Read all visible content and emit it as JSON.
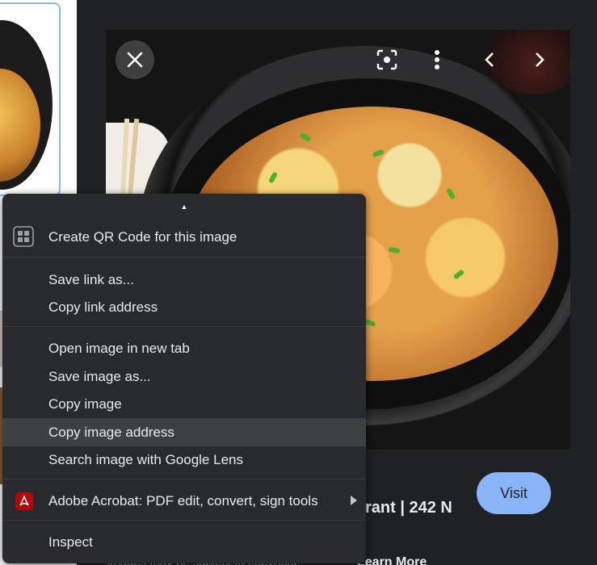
{
  "results_panel": {
    "title_fragment": "rant | 242 N",
    "caption_fragment": "Images may be subject to copyright.",
    "learn_more_fragment": "Learn More",
    "visit_label": "Visit"
  },
  "overlay_icons": [
    "close-icon",
    "lens-icon",
    "more-vert-icon",
    "chevron-left-icon",
    "chevron-right-icon"
  ],
  "context_menu": {
    "scroll_up_glyph": "▲",
    "items": [
      {
        "label": "Create QR Code for this image",
        "icon": "qr-code-icon"
      },
      {
        "label": "Save link as..."
      },
      {
        "label": "Copy link address"
      },
      {
        "label": "Open image in new tab"
      },
      {
        "label": "Save image as..."
      },
      {
        "label": "Copy image"
      },
      {
        "label": "Copy image address",
        "highlighted": true
      },
      {
        "label": "Search image with Google Lens"
      },
      {
        "label": "Adobe Acrobat: PDF edit, convert, sign tools",
        "icon": "adobe-acrobat-icon",
        "has_submenu": true
      },
      {
        "label": "Inspect"
      }
    ]
  },
  "colors": {
    "panel_bg": "#202124",
    "menu_bg": "#292a2d",
    "menu_highlight": "#3f4043",
    "menu_text": "#e8eaed",
    "visit_button": "#8ab4f8",
    "acrobat_red": "#b4070b"
  }
}
